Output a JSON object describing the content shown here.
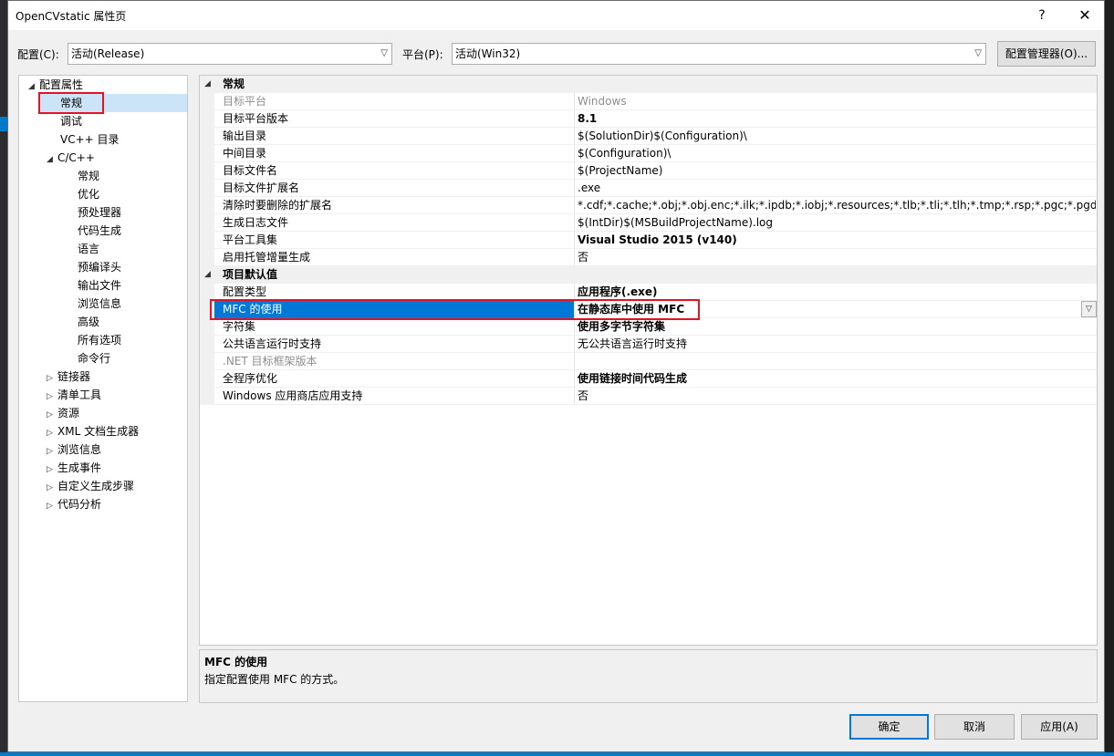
{
  "window": {
    "title": "OpenCVstatic 属性页",
    "help_glyph": "?",
    "close_glyph": "✕"
  },
  "config": {
    "config_label": "配置(C):",
    "config_value": "活动(Release)",
    "platform_label": "平台(P):",
    "platform_value": "活动(Win32)",
    "manager_button": "配置管理器(O)..."
  },
  "tree": {
    "root": "配置属性",
    "items": [
      {
        "label": "常规"
      },
      {
        "label": "调试"
      },
      {
        "label": "VC++ 目录"
      },
      {
        "label": "C/C++"
      },
      {
        "label": "常规"
      },
      {
        "label": "优化"
      },
      {
        "label": "预处理器"
      },
      {
        "label": "代码生成"
      },
      {
        "label": "语言"
      },
      {
        "label": "预编译头"
      },
      {
        "label": "输出文件"
      },
      {
        "label": "浏览信息"
      },
      {
        "label": "高级"
      },
      {
        "label": "所有选项"
      },
      {
        "label": "命令行"
      },
      {
        "label": "链接器"
      },
      {
        "label": "清单工具"
      },
      {
        "label": "资源"
      },
      {
        "label": "XML 文档生成器"
      },
      {
        "label": "浏览信息"
      },
      {
        "label": "生成事件"
      },
      {
        "label": "自定义生成步骤"
      },
      {
        "label": "代码分析"
      }
    ]
  },
  "grid": {
    "cat_general": "常规",
    "general": [
      {
        "name": "目标平台",
        "value": "Windows"
      },
      {
        "name": "目标平台版本",
        "value": "8.1"
      },
      {
        "name": "输出目录",
        "value": "$(SolutionDir)$(Configuration)\\"
      },
      {
        "name": "中间目录",
        "value": "$(Configuration)\\"
      },
      {
        "name": "目标文件名",
        "value": "$(ProjectName)"
      },
      {
        "name": "目标文件扩展名",
        "value": ".exe"
      },
      {
        "name": "清除时要删除的扩展名",
        "value": "*.cdf;*.cache;*.obj;*.obj.enc;*.ilk;*.ipdb;*.iobj;*.resources;*.tlb;*.tli;*.tlh;*.tmp;*.rsp;*.pgc;*.pgd;*.meta;*"
      },
      {
        "name": "生成日志文件",
        "value": "$(IntDir)$(MSBuildProjectName).log"
      },
      {
        "name": "平台工具集",
        "value": "Visual Studio 2015 (v140)"
      },
      {
        "name": "启用托管增量生成",
        "value": "否"
      }
    ],
    "cat_defaults": "项目默认值",
    "defaults": [
      {
        "name": "配置类型",
        "value": "应用程序(.exe)"
      },
      {
        "name": "MFC 的使用",
        "value": "在静态库中使用 MFC"
      },
      {
        "name": "字符集",
        "value": "使用多字节字符集"
      },
      {
        "name": "公共语言运行时支持",
        "value": "无公共语言运行时支持"
      },
      {
        "name": ".NET 目标框架版本",
        "value": ""
      },
      {
        "name": "全程序优化",
        "value": "使用链接时间代码生成"
      },
      {
        "name": "Windows 应用商店应用支持",
        "value": "否"
      }
    ]
  },
  "description": {
    "title": "MFC 的使用",
    "text": "指定配置使用 MFC 的方式。"
  },
  "buttons": {
    "ok": "确定",
    "cancel": "取消",
    "apply": "应用(A)"
  },
  "colors": {
    "selection": "#0078d7",
    "highlight_box": "#e81123",
    "tree_selection": "#cce4f7"
  },
  "icons": {
    "expanded": "◢",
    "collapsed": "▷",
    "dropdown": "chevron-down-icon"
  }
}
